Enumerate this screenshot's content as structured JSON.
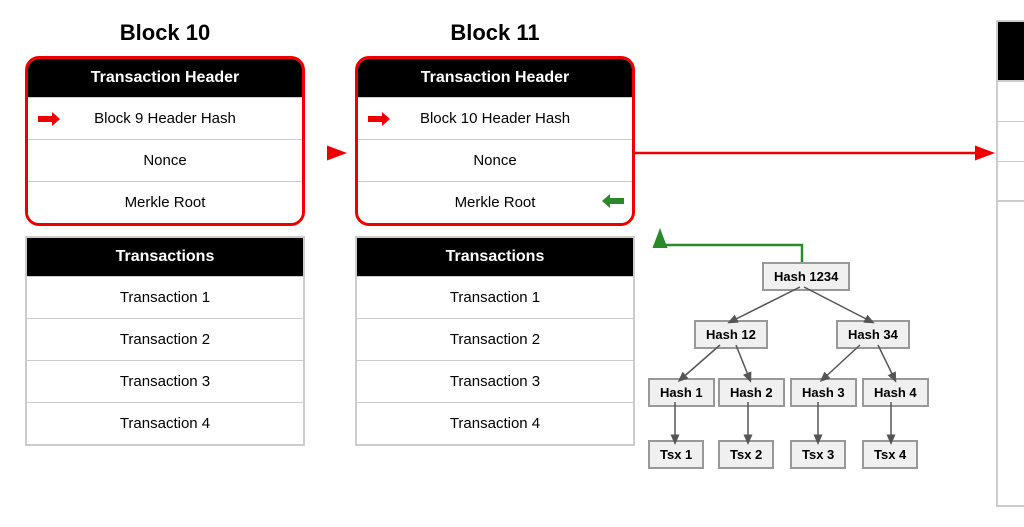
{
  "blocks": [
    {
      "id": "block10",
      "title": "Block 10",
      "header_label": "Transaction Header",
      "prev_hash_label": "Block 9 Header Hash",
      "nonce_label": "Nonce",
      "merkle_label": "Merkle Root",
      "transactions_label": "Transactions",
      "transactions": [
        "Transaction 1",
        "Transaction 2",
        "Transaction 3",
        "Transaction 4"
      ]
    },
    {
      "id": "block11",
      "title": "Block 11",
      "header_label": "Transaction Header",
      "prev_hash_label": "Block 10 Header Hash",
      "nonce_label": "Nonce",
      "merkle_label": "Merkle Root",
      "transactions_label": "Transactions",
      "transactions": [
        "Transaction 1",
        "Transaction 2",
        "Transaction 3",
        "Transaction 4"
      ]
    }
  ],
  "merkle_tree": {
    "root": "Hash 1234",
    "level1": [
      "Hash 12",
      "Hash 34"
    ],
    "level2": [
      "Hash 1",
      "Hash 2",
      "Hash 3",
      "Hash 4"
    ],
    "level3": [
      "Tsx 1",
      "Tsx 2",
      "Tsx 3",
      "Tsx 4"
    ]
  },
  "partial_block_visible": true
}
